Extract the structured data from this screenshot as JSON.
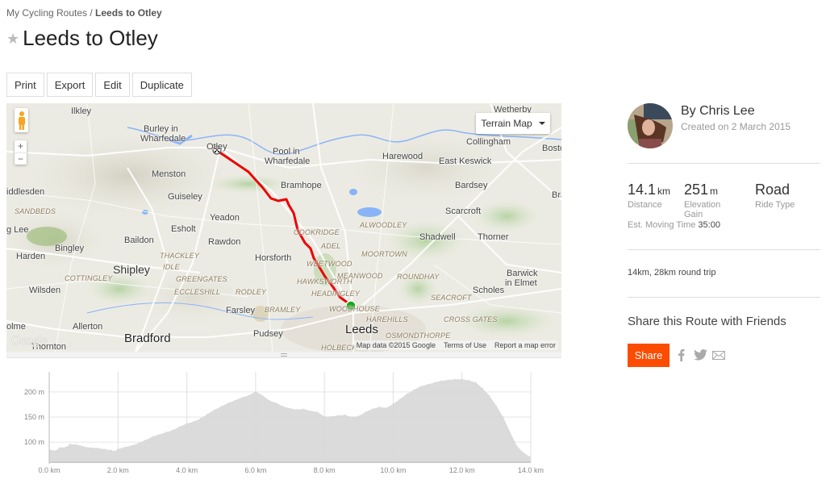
{
  "breadcrumb": {
    "parent": "My Cycling Routes",
    "separator": " / ",
    "current": "Leeds to Otley"
  },
  "title": "Leeds to Otley",
  "star_icon": "star-icon",
  "toolbar": {
    "print": "Print",
    "export": "Export",
    "edit": "Edit",
    "duplicate": "Duplicate"
  },
  "map": {
    "map_type": "Terrain Map",
    "attribution": "Map data ©2015 Google",
    "terms": "Terms of Use",
    "report": "Report a map error",
    "google_logo": "Google",
    "route_color": "#ee0000",
    "start_marker_color": "#18a818",
    "places": [
      {
        "name": "Ilkley",
        "cls": ""
      },
      {
        "name": "Burley in",
        "cls": ""
      },
      {
        "name": "Wharfedale",
        "cls": ""
      },
      {
        "name": "Otley",
        "cls": ""
      },
      {
        "name": "Pool in",
        "cls": ""
      },
      {
        "name": "Wharfedale",
        "cls": ""
      },
      {
        "name": "Wetherby",
        "cls": ""
      },
      {
        "name": "Collingham",
        "cls": ""
      },
      {
        "name": "Bosto",
        "cls": ""
      },
      {
        "name": "Harewood",
        "cls": ""
      },
      {
        "name": "East Keswick",
        "cls": ""
      },
      {
        "name": "Menston",
        "cls": ""
      },
      {
        "name": "Bramhope",
        "cls": ""
      },
      {
        "name": "Bardsey",
        "cls": ""
      },
      {
        "name": "Bra",
        "cls": ""
      },
      {
        "name": "iddlesden",
        "cls": ""
      },
      {
        "name": "Guiseley",
        "cls": ""
      },
      {
        "name": "SANDBEDS",
        "cls": "district"
      },
      {
        "name": "Yeadon",
        "cls": ""
      },
      {
        "name": "Scarcroft",
        "cls": ""
      },
      {
        "name": "ALWOODLEY",
        "cls": "district"
      },
      {
        "name": "g Lee",
        "cls": ""
      },
      {
        "name": "Esholt",
        "cls": ""
      },
      {
        "name": "COOKRIDGE",
        "cls": "district"
      },
      {
        "name": "Baildon",
        "cls": ""
      },
      {
        "name": "Rawdon",
        "cls": ""
      },
      {
        "name": "Shadwell",
        "cls": ""
      },
      {
        "name": "Thorner",
        "cls": ""
      },
      {
        "name": "Bingley",
        "cls": ""
      },
      {
        "name": "ADEL",
        "cls": "district"
      },
      {
        "name": "Harden",
        "cls": ""
      },
      {
        "name": "THACKLEY",
        "cls": "district"
      },
      {
        "name": "Horsforth",
        "cls": ""
      },
      {
        "name": "MOORTOWN",
        "cls": "district"
      },
      {
        "name": "WEETWOOD",
        "cls": "district"
      },
      {
        "name": "Shipley",
        "cls": "big"
      },
      {
        "name": "IDLE",
        "cls": "district"
      },
      {
        "name": "COTTINGLEY",
        "cls": "district"
      },
      {
        "name": "GREENGATES",
        "cls": "district"
      },
      {
        "name": "HAWKSWORTH",
        "cls": "district"
      },
      {
        "name": "MEANWOOD",
        "cls": "district"
      },
      {
        "name": "ROUNDHAY",
        "cls": "district"
      },
      {
        "name": "Barwick",
        "cls": ""
      },
      {
        "name": "in Elmet",
        "cls": ""
      },
      {
        "name": "Wilsden",
        "cls": ""
      },
      {
        "name": "ECCLESHILL",
        "cls": "district"
      },
      {
        "name": "RODLEY",
        "cls": "district"
      },
      {
        "name": "HEADINGLEY",
        "cls": "district"
      },
      {
        "name": "Scholes",
        "cls": ""
      },
      {
        "name": "SEACROFT",
        "cls": "district"
      },
      {
        "name": "Farsley",
        "cls": ""
      },
      {
        "name": "BRAMLEY",
        "cls": "district"
      },
      {
        "name": "WOODHOUSE",
        "cls": "district"
      },
      {
        "name": "olme",
        "cls": ""
      },
      {
        "name": "Allerton",
        "cls": ""
      },
      {
        "name": "HAREHILLS",
        "cls": "district"
      },
      {
        "name": "CROSS GATES",
        "cls": "district"
      },
      {
        "name": "Leeds",
        "cls": "huge"
      },
      {
        "name": "Bradford",
        "cls": "huge"
      },
      {
        "name": "Pudsey",
        "cls": ""
      },
      {
        "name": "Thornton",
        "cls": ""
      },
      {
        "name": "OSMONDTHORPE",
        "cls": "district"
      },
      {
        "name": "HOLBECK",
        "cls": "district"
      }
    ]
  },
  "author": {
    "name": "By Chris Lee",
    "created": "Created on 2 March 2015"
  },
  "stats": [
    {
      "value": "14.1",
      "unit": "km",
      "label": "Distance"
    },
    {
      "value": "251",
      "unit": "m",
      "label": "Elevation Gain"
    },
    {
      "value": "Road",
      "unit": "",
      "label": "Ride Type"
    }
  ],
  "est_moving_time": {
    "label": "Est. Moving Time",
    "value": "35:00"
  },
  "description": "14km, 28km round trip",
  "share": {
    "title": "Share this Route with Friends",
    "button": "Share",
    "icons": [
      "facebook-icon",
      "twitter-icon",
      "email-icon"
    ]
  },
  "chart_data": {
    "type": "area",
    "title": "",
    "xlabel": "",
    "ylabel": "",
    "x_unit": "km",
    "y_unit": "m",
    "xlim": [
      0,
      14
    ],
    "ylim": [
      60,
      240
    ],
    "x_ticks": [
      "0.0 km",
      "2.0 km",
      "4.0 km",
      "6.0 km",
      "8.0 km",
      "10.0 km",
      "12.0 km",
      "14.0 km"
    ],
    "y_ticks": [
      "100 m",
      "150 m",
      "200 m"
    ],
    "grid": true,
    "legend": "none",
    "series": [
      {
        "name": "Elevation",
        "color": "#d9d9d9",
        "x": [
          0.0,
          0.2,
          0.3,
          0.5,
          0.6,
          0.8,
          0.9,
          1.0,
          1.2,
          1.4,
          1.6,
          1.8,
          1.9,
          2.0,
          2.2,
          2.4,
          2.6,
          2.8,
          3.0,
          3.2,
          3.4,
          3.6,
          3.8,
          4.0,
          4.2,
          4.4,
          4.6,
          4.8,
          5.0,
          5.2,
          5.4,
          5.6,
          5.8,
          6.0,
          6.2,
          6.4,
          6.6,
          6.8,
          7.0,
          7.2,
          7.4,
          7.6,
          7.8,
          8.0,
          8.2,
          8.4,
          8.6,
          8.8,
          9.0,
          9.2,
          9.4,
          9.6,
          9.8,
          10.0,
          10.2,
          10.4,
          10.6,
          10.8,
          11.0,
          11.2,
          11.4,
          11.6,
          11.8,
          12.0,
          12.2,
          12.4,
          12.6,
          12.8,
          13.0,
          13.2,
          13.4,
          13.6,
          13.8,
          14.0
        ],
        "values": [
          85,
          83,
          89,
          90,
          96,
          95,
          93,
          91,
          89,
          88,
          86,
          84,
          82,
          86,
          90,
          93,
          98,
          104,
          111,
          115,
          120,
          124,
          131,
          137,
          141,
          147,
          156,
          164,
          171,
          178,
          183,
          189,
          193,
          201,
          193,
          183,
          178,
          171,
          167,
          165,
          166,
          162,
          160,
          151,
          151,
          153,
          154,
          150,
          152,
          160,
          166,
          170,
          168,
          176,
          186,
          196,
          204,
          211,
          215,
          219,
          222,
          224,
          225,
          225,
          223,
          219,
          207,
          192,
          172,
          150,
          120,
          92,
          78,
          70
        ]
      }
    ]
  }
}
